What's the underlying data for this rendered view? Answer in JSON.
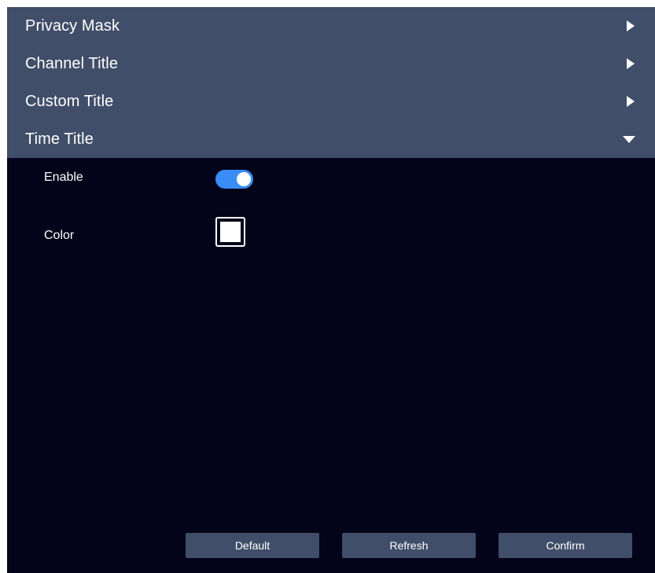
{
  "sections": [
    {
      "title": "Privacy Mask",
      "expanded": false,
      "chevron_icon": "caret-right-icon"
    },
    {
      "title": "Channel Title",
      "expanded": false,
      "chevron_icon": "caret-right-icon"
    },
    {
      "title": "Custom Title",
      "expanded": false,
      "chevron_icon": "caret-right-icon"
    },
    {
      "title": "Time Title",
      "expanded": true,
      "chevron_icon": "caret-down-icon"
    }
  ],
  "time_title": {
    "enable_label": "Enable",
    "enable_on": true,
    "color_label": "Color",
    "color_value": "#ffffff"
  },
  "buttons": {
    "default_label": "Default",
    "refresh_label": "Refresh",
    "confirm_label": "Confirm"
  },
  "colors": {
    "header_bg": "#414e69",
    "panel_bg": "#03031a",
    "toggle_on": "#3a8cf6",
    "button_bg": "#414e69"
  }
}
